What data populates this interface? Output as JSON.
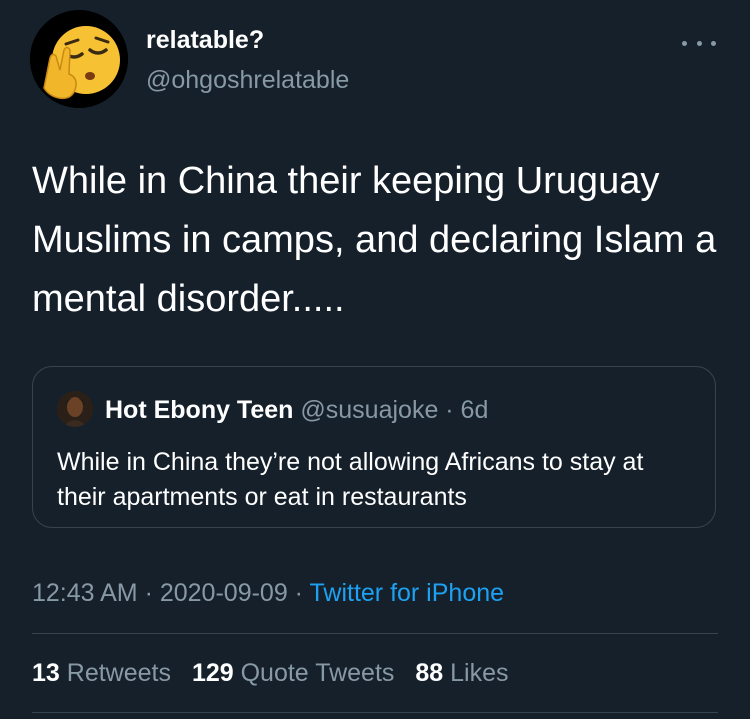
{
  "tweet": {
    "author": {
      "display_name": "relatable?",
      "handle": "@ohgoshrelatable",
      "avatar_icon": "pensive-face-emoji-icon"
    },
    "more_icon": "more-options-icon",
    "text": "While in China their keeping Uruguay Muslims in camps, and declaring Islam a mental disorder.....",
    "quoted_tweet": {
      "display_name": "Hot Ebony Teen",
      "meta": "@susuajoke · 6d",
      "text": "While in China they’re not allowing Africans to stay at their apartments or eat in restaurants"
    },
    "timestamp": "12:43 AM · 2020-09-09 · ",
    "source": "Twitter for iPhone",
    "stats": {
      "retweets_count": "13",
      "retweets_label": "Retweets",
      "quotes_count": "129",
      "quotes_label": "Quote Tweets",
      "likes_count": "88",
      "likes_label": "Likes"
    }
  },
  "colors": {
    "background": "#15202b",
    "primary_text": "#ffffff",
    "secondary_text": "#8899a6",
    "link": "#1da1f2",
    "border": "#38444d"
  }
}
